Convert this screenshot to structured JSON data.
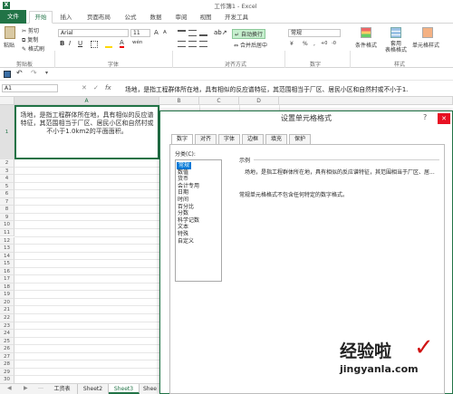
{
  "app": {
    "window_title": "工作簿1 - Excel",
    "help_icon": "?",
    "min_icon": "—",
    "max_icon": "☐",
    "close_icon": "✕"
  },
  "ribbon_tabs": [
    "文件",
    "开始",
    "插入",
    "页面布局",
    "公式",
    "数据",
    "审阅",
    "视图",
    "开发工具"
  ],
  "ribbon": {
    "clipboard": {
      "paste": "粘贴",
      "cut": "剪切",
      "copy": "复制",
      "format_painter": "格式刷",
      "group": "剪贴板"
    },
    "font": {
      "name": "Arial",
      "size": "11",
      "grow": "A",
      "shrink": "A",
      "bold": "B",
      "italic": "I",
      "underline": "U",
      "group": "字体",
      "color_letter": "A",
      "phonetic": "wén"
    },
    "alignment": {
      "wrap": "自动换行",
      "merge": "合并后居中",
      "group": "对齐方式"
    },
    "number": {
      "format": "常规",
      "percent": "%",
      "comma": ",",
      "group": "数字"
    },
    "styles": {
      "conditional": "条件格式",
      "table": "套用\n表格格式",
      "cell": "单元格样式",
      "group": "样式"
    }
  },
  "formula_bar": {
    "name_box": "A1",
    "fx": "fx",
    "content": "场地，是指工程群体所在地，具有相似的反应谱特征，其范围相当于厂区、居民小区和自然村或不小于1."
  },
  "columns": [
    "A",
    "B",
    "C",
    "D"
  ],
  "row_numbers": [
    "1",
    "2",
    "3",
    "4",
    "5",
    "6",
    "7",
    "8",
    "9",
    "10",
    "11",
    "12",
    "13",
    "14",
    "15",
    "16",
    "17",
    "18",
    "19",
    "20",
    "21",
    "22",
    "23",
    "24",
    "25",
    "26",
    "27",
    "28",
    "29",
    "30"
  ],
  "cell_a1": "场地，是指工程群体所在地，具有相似的反应谱特征，其范围相当于厂区、居民小区和自然村或不小于1.0km2的平面面积。",
  "sheet_tabs": [
    "工资表",
    "Sheet2",
    "Sheet3",
    "Shee"
  ],
  "dialog": {
    "title": "设置单元格格式",
    "tabs": [
      "数字",
      "对齐",
      "字体",
      "边框",
      "填充",
      "保护"
    ],
    "category_label": "分类(C):",
    "categories": [
      "常规",
      "数值",
      "货币",
      "会计专用",
      "日期",
      "时间",
      "百分比",
      "分数",
      "科学记数",
      "文本",
      "特殊",
      "自定义"
    ],
    "selected_category": "常规",
    "sample_label": "示例",
    "sample_text": "场地，是指工程群体所在地，具有相似的反应谱特征，其范围相当于厂区、居...",
    "description": "常规单元格格式不包含任何特定的数字格式。"
  },
  "watermark": {
    "line1": "经验啦",
    "check": "✓",
    "line2": "jingyanla.com"
  }
}
